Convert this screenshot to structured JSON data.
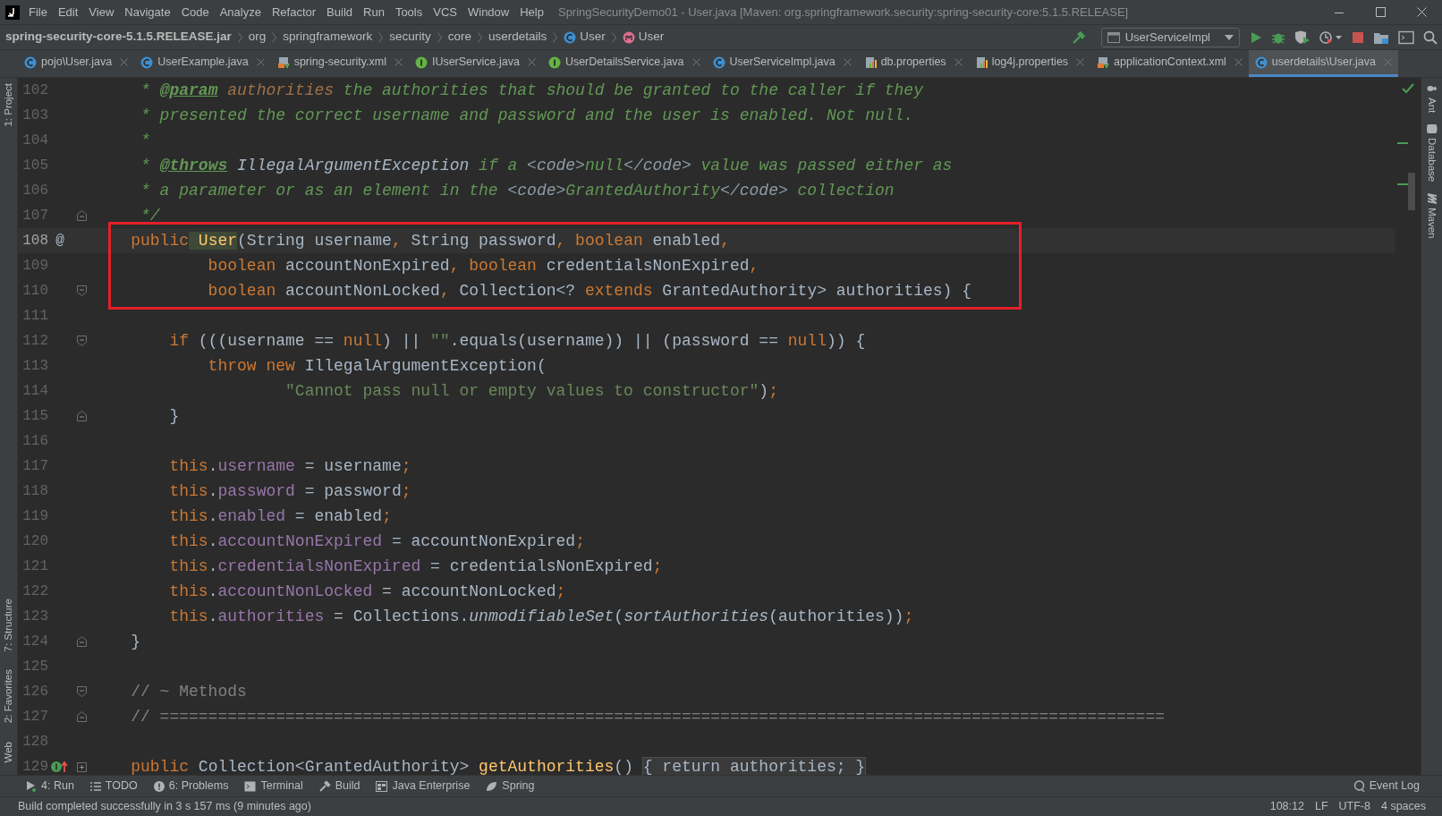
{
  "window": {
    "title": "SpringSecurityDemo01 - User.java [Maven: org.springframework.security:spring-security-core:5.1.5.RELEASE]"
  },
  "menu": [
    "File",
    "Edit",
    "View",
    "Navigate",
    "Code",
    "Analyze",
    "Refactor",
    "Build",
    "Run",
    "Tools",
    "VCS",
    "Window",
    "Help"
  ],
  "breadcrumbs": [
    {
      "text": "spring-security-core-5.1.5.RELEASE.jar",
      "kind": "archive"
    },
    {
      "text": "org",
      "kind": "package"
    },
    {
      "text": "springframework",
      "kind": "package"
    },
    {
      "text": "security",
      "kind": "package"
    },
    {
      "text": "core",
      "kind": "package"
    },
    {
      "text": "userdetails",
      "kind": "package"
    },
    {
      "text": "User",
      "kind": "class"
    },
    {
      "text": "User",
      "kind": "method"
    }
  ],
  "run_config": "UserServiceImpl",
  "tabs": [
    {
      "label": "pojo\\User.java",
      "kind": "class",
      "selected": false
    },
    {
      "label": "UserExample.java",
      "kind": "class",
      "selected": false
    },
    {
      "label": "spring-security.xml",
      "kind": "xml",
      "selected": false
    },
    {
      "label": "IUserService.java",
      "kind": "interface",
      "selected": false
    },
    {
      "label": "UserDetailsService.java",
      "kind": "interface",
      "selected": false
    },
    {
      "label": "UserServiceImpl.java",
      "kind": "class",
      "selected": false
    },
    {
      "label": "db.properties",
      "kind": "properties",
      "selected": false
    },
    {
      "label": "log4j.properties",
      "kind": "properties",
      "selected": false
    },
    {
      "label": "applicationContext.xml",
      "kind": "xml",
      "selected": false
    },
    {
      "label": "userdetails\\User.java",
      "kind": "class",
      "selected": true
    }
  ],
  "left_strip": [
    "1: Project",
    "7: Structure",
    "2: Favorites",
    "Web"
  ],
  "right_strip": [
    "Ant",
    "Database",
    "Maven"
  ],
  "lines": [
    {
      "number": "102",
      "tokens": [
        {
          "kind": "doc",
          "text": "     * "
        },
        {
          "kind": "doctag",
          "text": "@param"
        },
        {
          "kind": "docparam",
          "text": " authorities"
        },
        {
          "kind": "doc",
          "text": " the authorities that should be granted to the caller if they"
        }
      ]
    },
    {
      "number": "103",
      "tokens": [
        {
          "kind": "doc",
          "text": "     * presented the correct username and password and the user is enabled. Not null."
        }
      ]
    },
    {
      "number": "104",
      "tokens": [
        {
          "kind": "doc",
          "text": "     *"
        }
      ]
    },
    {
      "number": "105",
      "tokens": [
        {
          "kind": "doc",
          "text": "     * "
        },
        {
          "kind": "doctag",
          "text": "@throws"
        },
        {
          "kind": "docref",
          "text": " IllegalArgumentException"
        },
        {
          "kind": "doc",
          "text": " if a "
        },
        {
          "kind": "docmarkup",
          "text": "<code>"
        },
        {
          "kind": "doc",
          "text": "null"
        },
        {
          "kind": "docmarkup",
          "text": "</code>"
        },
        {
          "kind": "doc",
          "text": " value was passed either as"
        }
      ]
    },
    {
      "number": "106",
      "tokens": [
        {
          "kind": "doc",
          "text": "     * a parameter or as an element in the "
        },
        {
          "kind": "docmarkup",
          "text": "<code>"
        },
        {
          "kind": "doc",
          "text": "GrantedAuthority"
        },
        {
          "kind": "docmarkup",
          "text": "</code>"
        },
        {
          "kind": "doc",
          "text": " collection"
        }
      ]
    },
    {
      "number": "107",
      "fold_end": true,
      "tokens": [
        {
          "kind": "doc",
          "text": "     */"
        }
      ]
    },
    {
      "number": "108",
      "current": true,
      "boxed": true,
      "gutter_mark": "@",
      "tokens": [
        {
          "kind": "keyword",
          "text": "    public"
        },
        {
          "kind": "decl_marked",
          "text": " User"
        },
        {
          "kind": "plain",
          "text": "(String username"
        },
        {
          "kind": "keyword",
          "text": ","
        },
        {
          "kind": "plain",
          "text": " String password"
        },
        {
          "kind": "keyword",
          "text": ", boolean"
        },
        {
          "kind": "plain",
          "text": " enabled"
        },
        {
          "kind": "keyword",
          "text": ","
        }
      ]
    },
    {
      "number": "109",
      "boxed": true,
      "tokens": [
        {
          "kind": "keyword",
          "text": "            boolean"
        },
        {
          "kind": "plain",
          "text": " accountNonExpired"
        },
        {
          "kind": "keyword",
          "text": ", boolean"
        },
        {
          "kind": "plain",
          "text": " credentialsNonExpired"
        },
        {
          "kind": "keyword",
          "text": ","
        }
      ]
    },
    {
      "number": "110",
      "boxed": true,
      "fold_start": true,
      "tokens": [
        {
          "kind": "keyword",
          "text": "            boolean"
        },
        {
          "kind": "plain",
          "text": " accountNonLocked"
        },
        {
          "kind": "keyword",
          "text": ","
        },
        {
          "kind": "plain",
          "text": " Collection<? "
        },
        {
          "kind": "keyword",
          "text": "extends"
        },
        {
          "kind": "plain",
          "text": " GrantedAuthority> authorities) {"
        }
      ]
    },
    {
      "number": "111"
    },
    {
      "number": "112",
      "fold_start": true,
      "tokens": [
        {
          "kind": "keyword",
          "text": "        if"
        },
        {
          "kind": "plain",
          "text": " (((username == "
        },
        {
          "kind": "keyword",
          "text": "null"
        },
        {
          "kind": "plain",
          "text": ") || "
        },
        {
          "kind": "string",
          "text": "\"\""
        },
        {
          "kind": "plain",
          "text": ".equals(username)) || (password == "
        },
        {
          "kind": "keyword",
          "text": "null"
        },
        {
          "kind": "plain",
          "text": ")) {"
        }
      ]
    },
    {
      "number": "113",
      "tokens": [
        {
          "kind": "keyword",
          "text": "            throw new"
        },
        {
          "kind": "plain",
          "text": " IllegalArgumentException("
        }
      ]
    },
    {
      "number": "114",
      "tokens": [
        {
          "kind": "string",
          "text": "                    \"Cannot pass null or empty values to constructor\""
        },
        {
          "kind": "plain",
          "text": ")"
        },
        {
          "kind": "keyword",
          "text": ";"
        }
      ]
    },
    {
      "number": "115",
      "fold_end": true,
      "tokens": [
        {
          "kind": "plain",
          "text": "        }"
        }
      ]
    },
    {
      "number": "116"
    },
    {
      "number": "117",
      "tokens": [
        {
          "kind": "keyword",
          "text": "        this"
        },
        {
          "kind": "plain",
          "text": "."
        },
        {
          "kind": "field",
          "text": "username"
        },
        {
          "kind": "plain",
          "text": " = username"
        },
        {
          "kind": "keyword",
          "text": ";"
        }
      ]
    },
    {
      "number": "118",
      "tokens": [
        {
          "kind": "keyword",
          "text": "        this"
        },
        {
          "kind": "plain",
          "text": "."
        },
        {
          "kind": "field",
          "text": "password"
        },
        {
          "kind": "plain",
          "text": " = password"
        },
        {
          "kind": "keyword",
          "text": ";"
        }
      ]
    },
    {
      "number": "119",
      "tokens": [
        {
          "kind": "keyword",
          "text": "        this"
        },
        {
          "kind": "plain",
          "text": "."
        },
        {
          "kind": "field",
          "text": "enabled"
        },
        {
          "kind": "plain",
          "text": " = enabled"
        },
        {
          "kind": "keyword",
          "text": ";"
        }
      ]
    },
    {
      "number": "120",
      "tokens": [
        {
          "kind": "keyword",
          "text": "        this"
        },
        {
          "kind": "plain",
          "text": "."
        },
        {
          "kind": "field",
          "text": "accountNonExpired"
        },
        {
          "kind": "plain",
          "text": " = accountNonExpired"
        },
        {
          "kind": "keyword",
          "text": ";"
        }
      ]
    },
    {
      "number": "121",
      "tokens": [
        {
          "kind": "keyword",
          "text": "        this"
        },
        {
          "kind": "plain",
          "text": "."
        },
        {
          "kind": "field",
          "text": "credentialsNonExpired"
        },
        {
          "kind": "plain",
          "text": " = credentialsNonExpired"
        },
        {
          "kind": "keyword",
          "text": ";"
        }
      ]
    },
    {
      "number": "122",
      "tokens": [
        {
          "kind": "keyword",
          "text": "        this"
        },
        {
          "kind": "plain",
          "text": "."
        },
        {
          "kind": "field",
          "text": "accountNonLocked"
        },
        {
          "kind": "plain",
          "text": " = accountNonLocked"
        },
        {
          "kind": "keyword",
          "text": ";"
        }
      ]
    },
    {
      "number": "123",
      "tokens": [
        {
          "kind": "keyword",
          "text": "        this"
        },
        {
          "kind": "plain",
          "text": "."
        },
        {
          "kind": "field",
          "text": "authorities"
        },
        {
          "kind": "plain",
          "text": " = Collections."
        },
        {
          "kind": "static",
          "text": "unmodifiableSet"
        },
        {
          "kind": "plain",
          "text": "("
        },
        {
          "kind": "static",
          "text": "sortAuthorities"
        },
        {
          "kind": "plain",
          "text": "(authorities))"
        },
        {
          "kind": "keyword",
          "text": ";"
        }
      ]
    },
    {
      "number": "124",
      "fold_end": true,
      "tokens": [
        {
          "kind": "plain",
          "text": "    }"
        }
      ]
    },
    {
      "number": "125"
    },
    {
      "number": "126",
      "fold_start": true,
      "tokens": [
        {
          "kind": "comment",
          "text": "    // ~ Methods"
        }
      ]
    },
    {
      "number": "127",
      "fold_end": true,
      "tokens": [
        {
          "kind": "comment",
          "text": "    // ========================================================================================================"
        }
      ]
    },
    {
      "number": "128"
    },
    {
      "number": "129",
      "collapsed": true,
      "implemented": true,
      "tokens": [
        {
          "kind": "keyword",
          "text": "    public"
        },
        {
          "kind": "plain",
          "text": " Collection<GrantedAuthority> "
        },
        {
          "kind": "decl",
          "text": "getAuthorities"
        },
        {
          "kind": "plain",
          "text": "() "
        },
        {
          "kind": "folded",
          "text": "{ return authorities; }"
        }
      ]
    }
  ],
  "tool_windows": [
    {
      "label": "4: Run",
      "kind": "run"
    },
    {
      "label": "TODO",
      "kind": "todo"
    },
    {
      "label": "6: Problems",
      "kind": "problems"
    },
    {
      "label": "Terminal",
      "kind": "terminal"
    },
    {
      "label": "Build",
      "kind": "build"
    },
    {
      "label": "Java Enterprise",
      "kind": "enterprise"
    },
    {
      "label": "Spring",
      "kind": "spring"
    }
  ],
  "event_log": "Event Log",
  "status_bar": {
    "message": "Build completed successfully in 3 s 157 ms (9 minutes ago)",
    "items": [
      "108:12",
      "LF",
      "UTF-8",
      "4 spaces"
    ]
  }
}
